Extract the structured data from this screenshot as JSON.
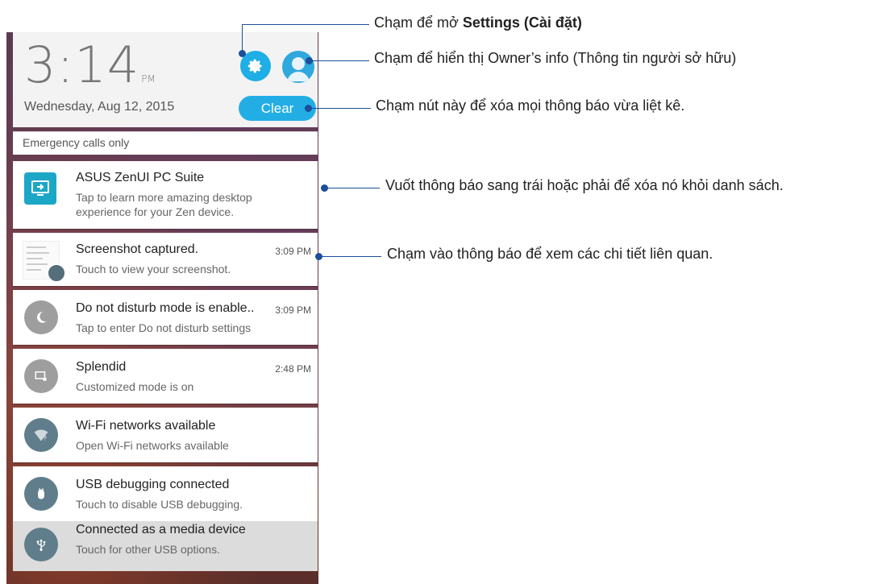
{
  "status": {
    "time": "3:14",
    "ampm": "PM",
    "date": "Wednesday, Aug 12, 2015",
    "clear_label": "Clear",
    "emergency": "Emergency calls only"
  },
  "icons": {
    "settings": "gear-icon",
    "owner": "avatar-icon"
  },
  "notifications": [
    {
      "title": "ASUS ZenUI PC Suite",
      "subtitle": "Tap to learn more amazing desktop",
      "subtitle2": "experience for your Zen device.",
      "time": ""
    },
    {
      "title": "Screenshot captured.",
      "subtitle": "Touch to view your screenshot.",
      "time": "3:09 PM"
    },
    {
      "title": "Do not disturb mode is enable..",
      "subtitle": "Tap to enter Do not disturb settings",
      "time": "3:09 PM"
    },
    {
      "title": "Splendid",
      "subtitle": "Customized mode is on",
      "time": "2:48 PM"
    },
    {
      "title": "Wi-Fi networks available",
      "subtitle": "Open Wi-Fi networks available",
      "time": ""
    },
    {
      "title": "USB debugging connected",
      "subtitle": "Touch to disable USB debugging.",
      "time": ""
    },
    {
      "title": "Connected as a media device",
      "subtitle": "Touch for other USB options.",
      "time": ""
    }
  ],
  "callouts": {
    "settings_prefix": "Chạm để mở ",
    "settings_bold": "Settings (Cài đặt)",
    "owner": "Chạm để hiển thị Owner’s info (Thông tin người sở hữu)",
    "clear": "Chạm nút này để xóa mọi thông báo vừa liệt kê.",
    "swipe": "Vuốt thông báo sang trái hoặc phải để xóa nó khỏi danh sách.",
    "tap": "Chạm vào thông báo để xem các chi tiết liên quan."
  },
  "colors": {
    "accent": "#1faee6",
    "callout_line": "#1b4f9a"
  }
}
